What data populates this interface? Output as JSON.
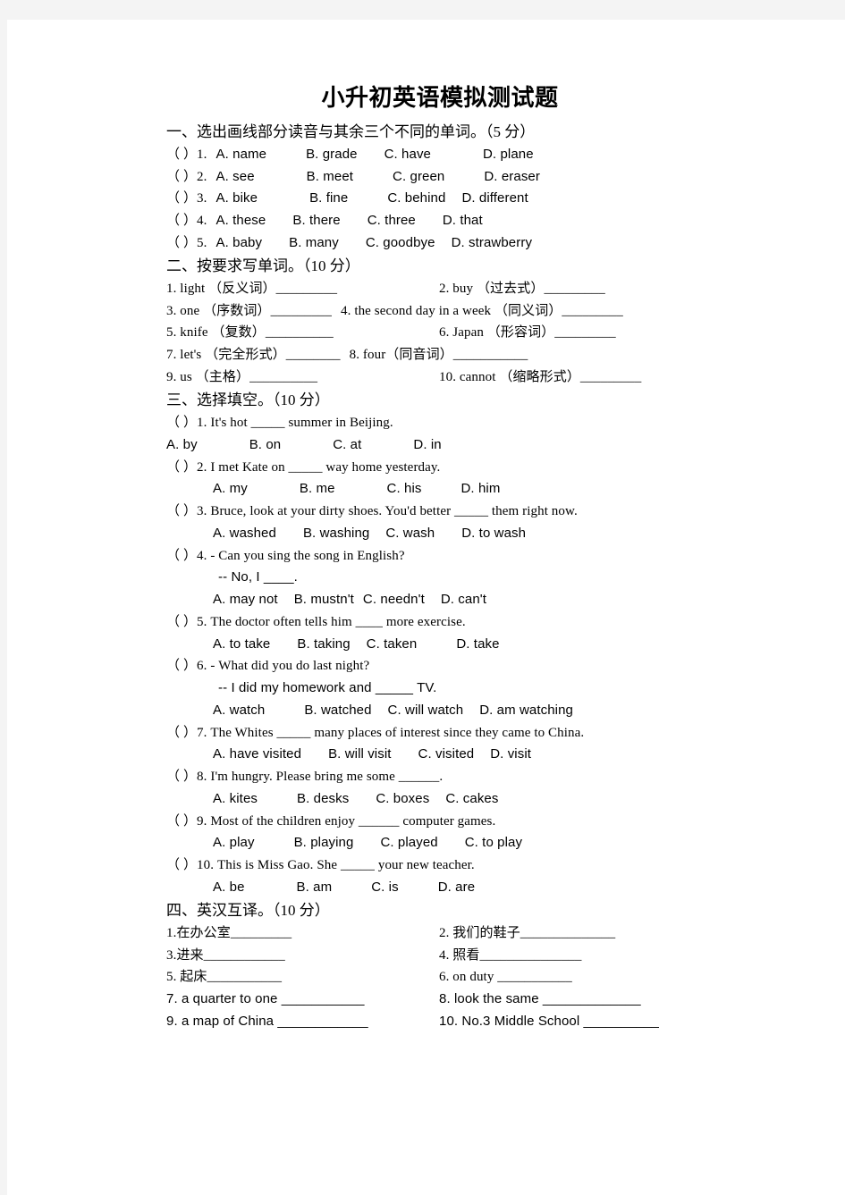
{
  "document": {
    "title": "小升初英语模拟测试题"
  },
  "sections": [
    {
      "id": "section-1",
      "heading": "一、选出画线部分读音与其余三个不同的单词。（5 分）",
      "items": [
        {
          "prefix": "（   ）1.",
          "options": [
            "A. name",
            "B. grade",
            "C. have",
            "D. plane"
          ]
        },
        {
          "prefix": "（   ）2.",
          "options": [
            "A. see",
            "B. meet",
            "C. green",
            "D. eraser"
          ]
        },
        {
          "prefix": "（   ）3.",
          "options": [
            "A. bike",
            "B. fine",
            "C. behind",
            "D. different"
          ]
        },
        {
          "prefix": "（   ）4.",
          "options": [
            "A. these",
            "B. there",
            "C. three",
            "D. that"
          ]
        },
        {
          "prefix": "（   ）5.",
          "options": [
            "A. baby",
            "B. many",
            "C. goodbye",
            "D. strawberry"
          ]
        }
      ]
    },
    {
      "id": "section-2",
      "heading": "二、按要求写单词。（10 分）",
      "rows": [
        {
          "left": "1. light  （反义词）_________",
          "right": "2. buy   （过去式）_________"
        },
        {
          "left": "3. one （序数词）_________",
          "right": "4. the second day in a week （同义词）_________"
        },
        {
          "left": "5. knife  （复数）__________",
          "right": "6. Japan  （形容词）_________"
        },
        {
          "left": "7. let's  （完全形式）________",
          "right": "8. four（同音词）___________"
        },
        {
          "left": "9. us  （主格）__________",
          "right": "10. cannot  （缩略形式）_________"
        }
      ]
    },
    {
      "id": "section-3",
      "heading": "三、选择填空。（10 分）",
      "questions": [
        {
          "stem": "（   ）1. It's hot _____ summer in Beijing.",
          "stem2": "",
          "options": [
            "A. by",
            "B. on",
            "C. at",
            "D. in"
          ],
          "options_indent": "none"
        },
        {
          "stem": "（   ）2. I met Kate on _____ way home yesterday.",
          "stem2": "",
          "options": [
            "A. my",
            "B. me",
            "C. his",
            "D. him"
          ],
          "options_indent": "indent1"
        },
        {
          "stem": "（   ）3. Bruce, look at your dirty shoes. You'd better _____ them right now.",
          "stem2": "",
          "options": [
            "A. washed",
            "B. washing",
            "C. wash",
            "D. to wash"
          ],
          "options_indent": "indent1"
        },
        {
          "stem": "（   ）4. - Can you sing the song in English?",
          "stem2": "-- No, I ____.",
          "options": [
            "A. may not",
            "B. mustn't",
            "C. needn't",
            "D. can't"
          ],
          "options_indent": "indent1"
        },
        {
          "stem": "（   ）5. The doctor often tells him ____ more exercise.",
          "stem2": "",
          "options": [
            "A. to take",
            "B. taking",
            "C. taken",
            "D. take"
          ],
          "options_indent": "indent1"
        },
        {
          "stem": "（   ）6. - What did you do last night?",
          "stem2": "-- I did my homework and _____ TV.",
          "options": [
            "A. watch",
            "B. watched",
            "C. will watch",
            "D. am watching"
          ],
          "options_indent": "indent1"
        },
        {
          "stem": "（   ）7. The Whites _____ many places of interest since they came to China.",
          "stem2": "",
          "options": [
            "A. have visited",
            "B. will visit",
            "C. visited",
            "D. visit"
          ],
          "options_indent": "indent1"
        },
        {
          "stem": "（   ）8. I'm hungry. Please bring me some ______.",
          "stem2": "",
          "options": [
            "A. kites",
            "B. desks",
            "C. boxes",
            "C. cakes"
          ],
          "options_indent": "indent1"
        },
        {
          "stem": "（   ）9. Most of the children enjoy ______ computer games.",
          "stem2": "",
          "options": [
            "A. play",
            "B. playing",
            "C. played",
            "C. to play"
          ],
          "options_indent": "indent1"
        },
        {
          "stem": "（   ）10. This is Miss Gao. She _____ your new teacher.",
          "stem2": "",
          "options": [
            "A. be",
            "B. am",
            "C. is",
            "D. are"
          ],
          "options_indent": "indent1"
        }
      ]
    },
    {
      "id": "section-4",
      "heading": "四、英汉互译。（10 分）",
      "rows": [
        {
          "left": "1.在办公室_________",
          "right": "2. 我们的鞋子______________"
        },
        {
          "left": "3.进来____________",
          "right": "4. 照看_______________"
        },
        {
          "left": "5. 起床___________",
          "right": "6. on duty ___________"
        },
        {
          "left": "7. a quarter to one ___________",
          "right": "8. look the same _____________"
        },
        {
          "left": "9. a map of China ____________",
          "right": "10. No.3 Middle School __________"
        }
      ]
    }
  ]
}
